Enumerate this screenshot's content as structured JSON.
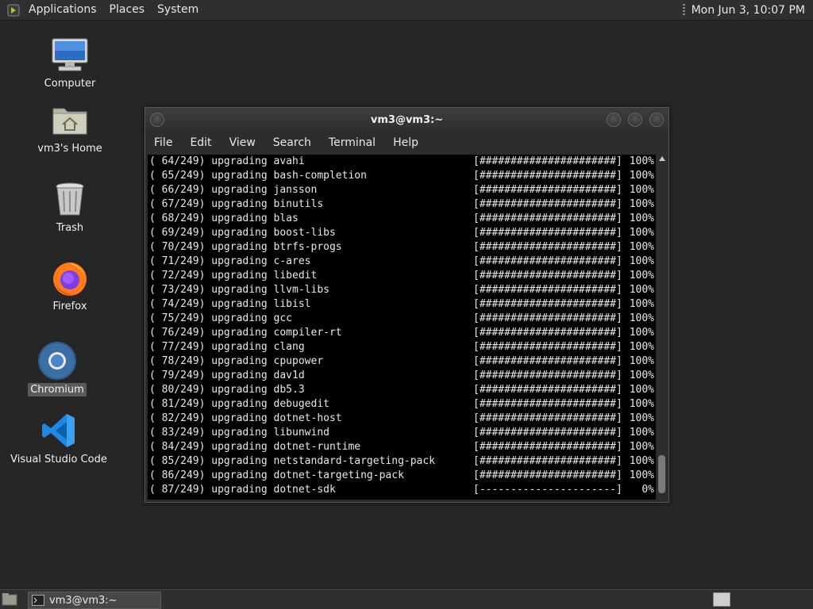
{
  "top_panel": {
    "menus": [
      "Applications",
      "Places",
      "System"
    ],
    "clock": "Mon Jun  3, 10:07 PM"
  },
  "desktop": {
    "icons": [
      {
        "label": "Computer",
        "icon": "computer-icon"
      },
      {
        "label": "vm3's Home",
        "icon": "home-folder-icon"
      },
      {
        "label": "Trash",
        "icon": "trash-icon"
      },
      {
        "label": "Firefox",
        "icon": "firefox-icon"
      },
      {
        "label": "Chromium",
        "icon": "chromium-icon",
        "selected": true
      },
      {
        "label": "Visual Studio Code",
        "icon": "vscode-icon"
      }
    ]
  },
  "terminal": {
    "title": "vm3@vm3:~",
    "menu": [
      "File",
      "Edit",
      "View",
      "Search",
      "Terminal",
      "Help"
    ],
    "lines": [
      {
        "n": "( 64/249) upgrading avahi",
        "bar": "[######################]",
        "pct": "100%"
      },
      {
        "n": "( 65/249) upgrading bash-completion",
        "bar": "[######################]",
        "pct": "100%"
      },
      {
        "n": "( 66/249) upgrading jansson",
        "bar": "[######################]",
        "pct": "100%"
      },
      {
        "n": "( 67/249) upgrading binutils",
        "bar": "[######################]",
        "pct": "100%"
      },
      {
        "n": "( 68/249) upgrading blas",
        "bar": "[######################]",
        "pct": "100%"
      },
      {
        "n": "( 69/249) upgrading boost-libs",
        "bar": "[######################]",
        "pct": "100%"
      },
      {
        "n": "( 70/249) upgrading btrfs-progs",
        "bar": "[######################]",
        "pct": "100%"
      },
      {
        "n": "( 71/249) upgrading c-ares",
        "bar": "[######################]",
        "pct": "100%"
      },
      {
        "n": "( 72/249) upgrading libedit",
        "bar": "[######################]",
        "pct": "100%"
      },
      {
        "n": "( 73/249) upgrading llvm-libs",
        "bar": "[######################]",
        "pct": "100%"
      },
      {
        "n": "( 74/249) upgrading libisl",
        "bar": "[######################]",
        "pct": "100%"
      },
      {
        "n": "( 75/249) upgrading gcc",
        "bar": "[######################]",
        "pct": "100%"
      },
      {
        "n": "( 76/249) upgrading compiler-rt",
        "bar": "[######################]",
        "pct": "100%"
      },
      {
        "n": "( 77/249) upgrading clang",
        "bar": "[######################]",
        "pct": "100%"
      },
      {
        "n": "( 78/249) upgrading cpupower",
        "bar": "[######################]",
        "pct": "100%"
      },
      {
        "n": "( 79/249) upgrading dav1d",
        "bar": "[######################]",
        "pct": "100%"
      },
      {
        "n": "( 80/249) upgrading db5.3",
        "bar": "[######################]",
        "pct": "100%"
      },
      {
        "n": "( 81/249) upgrading debugedit",
        "bar": "[######################]",
        "pct": "100%"
      },
      {
        "n": "( 82/249) upgrading dotnet-host",
        "bar": "[######################]",
        "pct": "100%"
      },
      {
        "n": "( 83/249) upgrading libunwind",
        "bar": "[######################]",
        "pct": "100%"
      },
      {
        "n": "( 84/249) upgrading dotnet-runtime",
        "bar": "[######################]",
        "pct": "100%"
      },
      {
        "n": "( 85/249) upgrading netstandard-targeting-pack",
        "bar": "[######################]",
        "pct": "100%"
      },
      {
        "n": "( 86/249) upgrading dotnet-targeting-pack",
        "bar": "[######################]",
        "pct": "100%"
      },
      {
        "n": "( 87/249) upgrading dotnet-sdk",
        "bar": "[----------------------]",
        "pct": "0%"
      }
    ]
  },
  "taskbar": {
    "window_button": "vm3@vm3:~"
  }
}
